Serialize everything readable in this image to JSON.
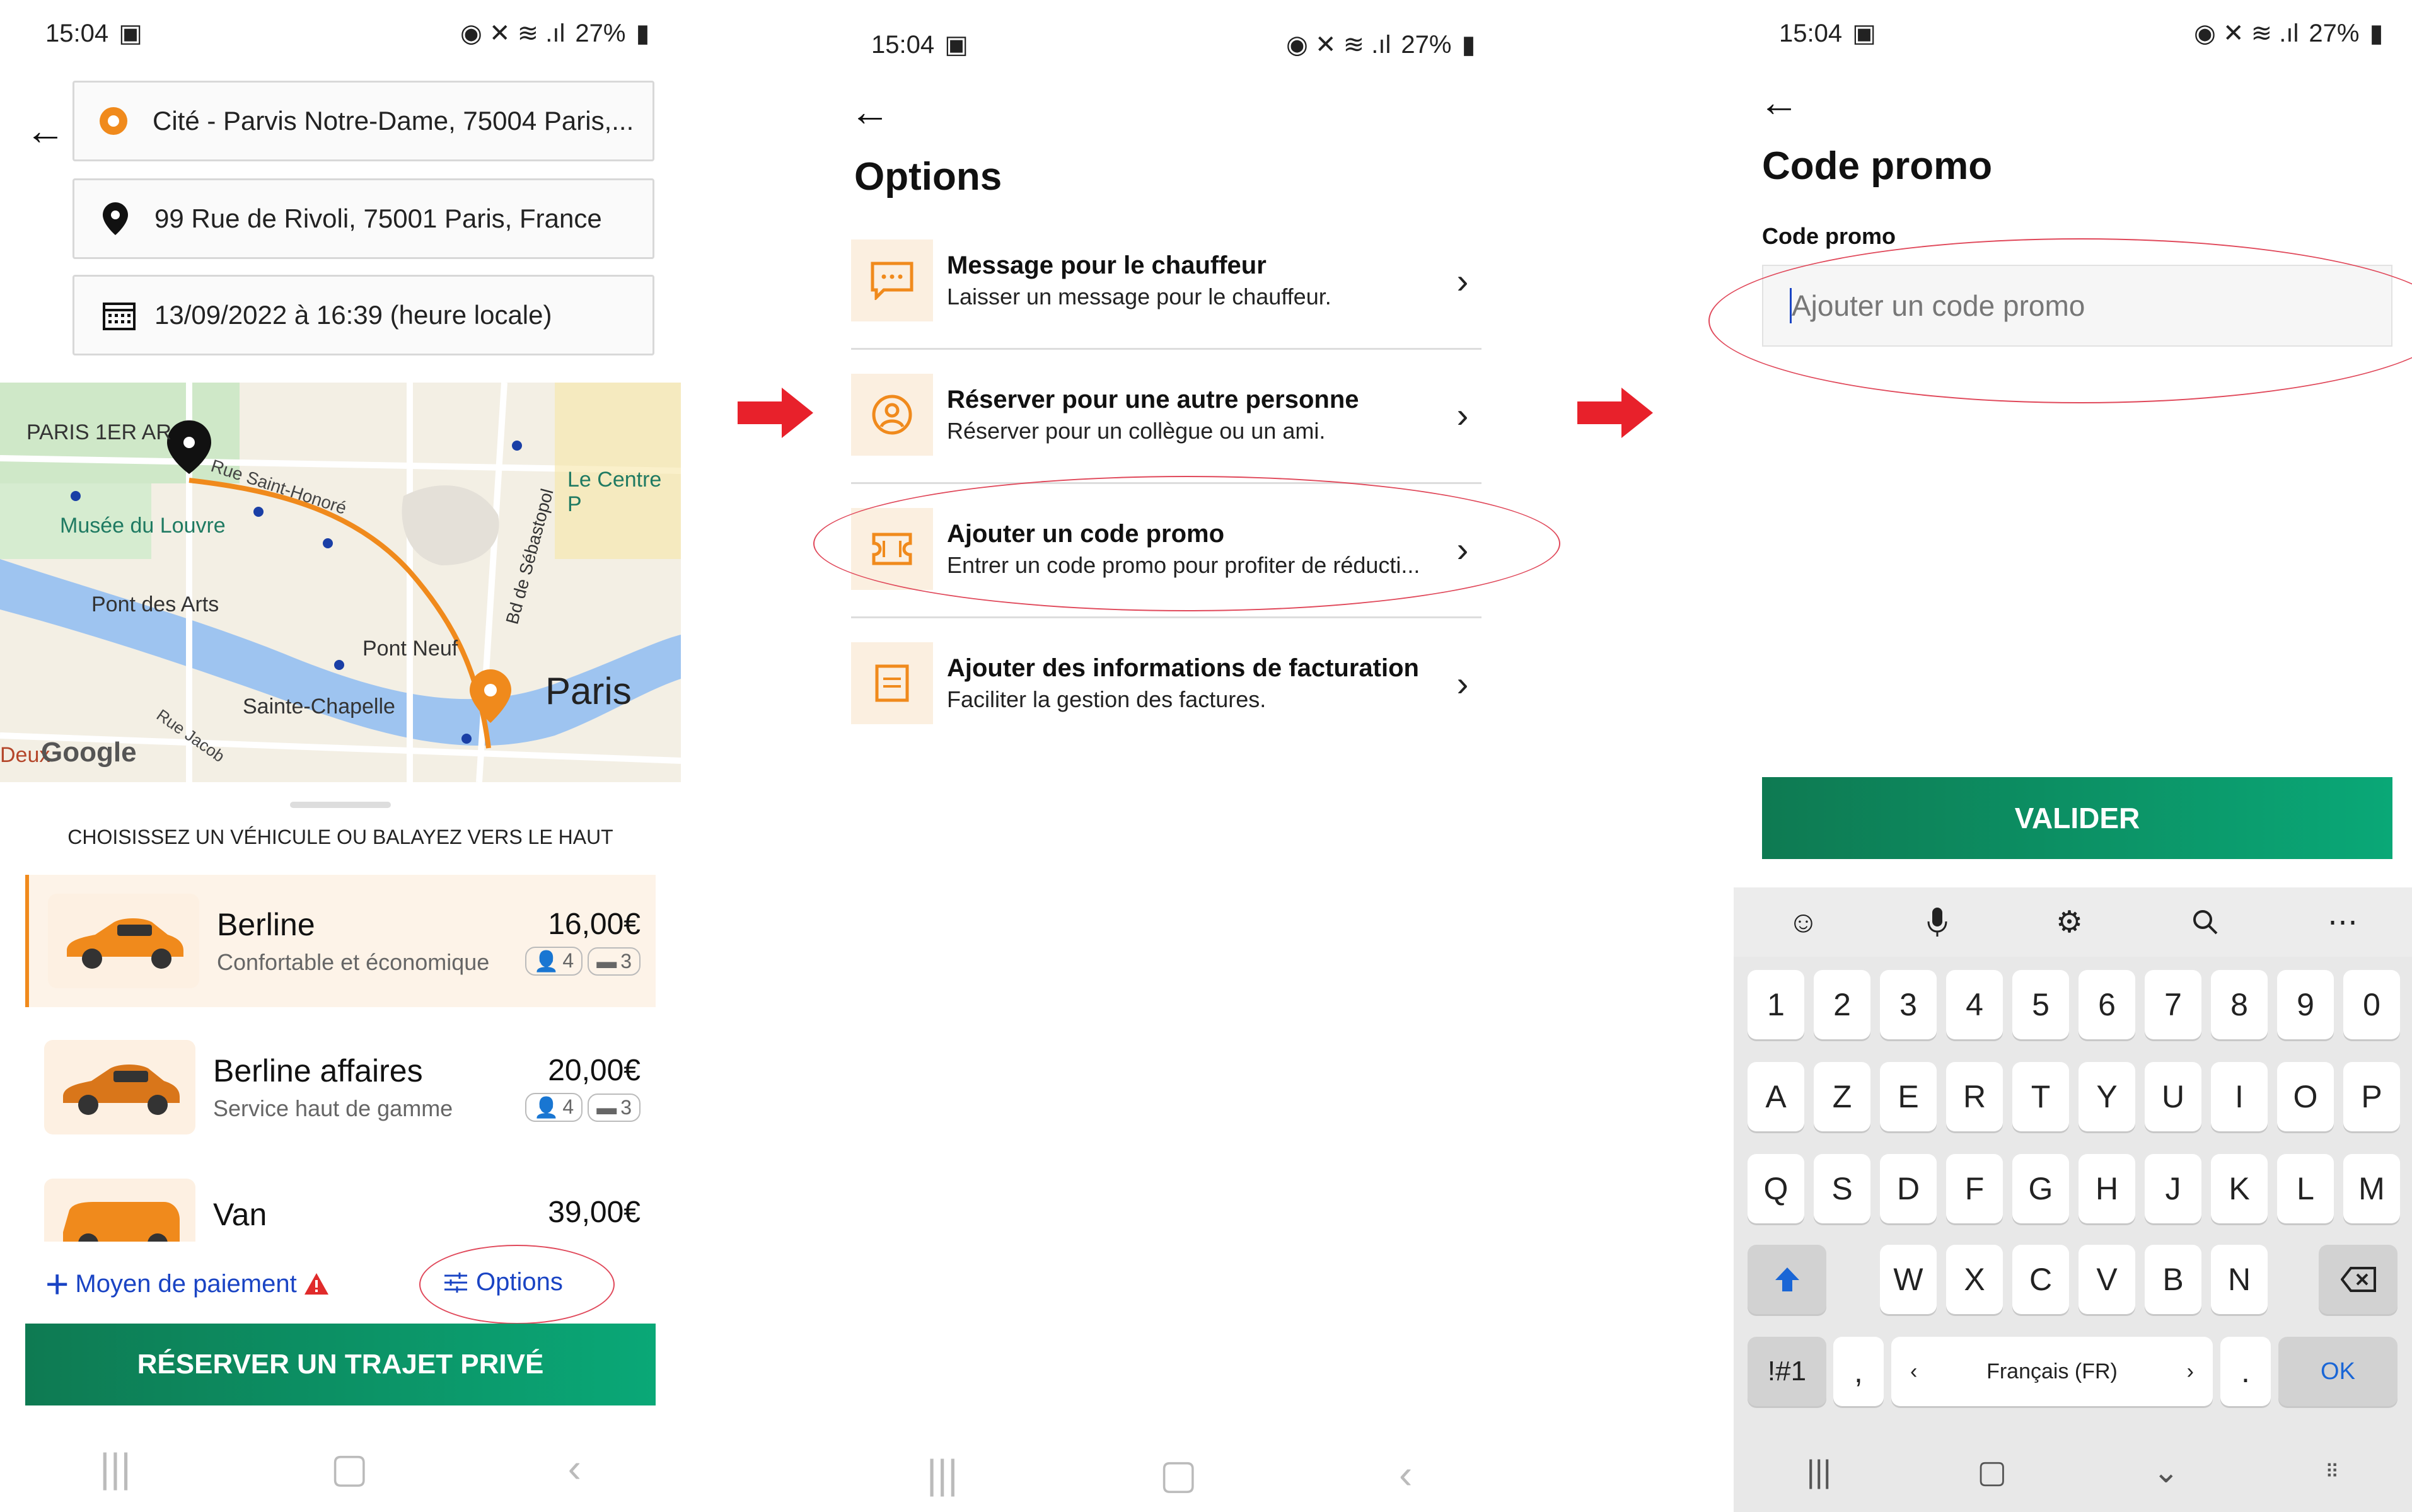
{
  "colors": {
    "orange": "#f08a1c",
    "green": "#0f8a5f",
    "blue": "#1a44c4",
    "red_arrow": "#e8212b",
    "annotation": "#e0485a"
  },
  "status": {
    "time": "15:04",
    "battery": "27%"
  },
  "screen1": {
    "pickup": "Cité - Parvis Notre-Dame, 75004 Paris,...",
    "dropoff": "99 Rue de Rivoli, 75001 Paris, France",
    "datetime": "13/09/2022 à 16:39 (heure locale)",
    "map": {
      "labels": [
        "PARIS 1ER AR",
        "Rue Saint-Honoré",
        "Musée du Louvre",
        "Le Centre P",
        "Bd de Sébastopol",
        "Pont des Arts",
        "Pont Neuf",
        "Paris",
        "Sainte-Chapelle",
        "Rue Jacob",
        "Deux"
      ],
      "google": "Google"
    },
    "prompt": "CHOISISSEZ UN VÉHICULE OU BALAYEZ VERS LE HAUT",
    "vehicles": [
      {
        "name": "Berline",
        "desc": "Confortable et économique",
        "price": "16,00€",
        "pax": "4",
        "bags": "3"
      },
      {
        "name": "Berline affaires",
        "desc": "Service haut de gamme",
        "price": "20,00€",
        "pax": "4",
        "bags": "3"
      },
      {
        "name": "Van",
        "price": "39,00€"
      }
    ],
    "payment": "Moyen de paiement",
    "options": "Options",
    "book": "RÉSERVER UN TRAJET PRIVÉ"
  },
  "screen2": {
    "title": "Options",
    "items": [
      {
        "title": "Message pour le chauffeur",
        "sub": "Laisser un message pour le chauffeur.",
        "icon": "message-icon"
      },
      {
        "title": "Réserver pour une autre personne",
        "sub": "Réserver pour un collègue ou un ami.",
        "icon": "person-icon"
      },
      {
        "title": "Ajouter un code promo",
        "sub": "Entrer un code promo pour profiter de réducti...",
        "icon": "ticket-icon"
      },
      {
        "title": "Ajouter des informations de facturation",
        "sub": "Faciliter la gestion des factures.",
        "icon": "invoice-icon"
      }
    ]
  },
  "screen3": {
    "title": "Code promo",
    "label": "Code promo",
    "placeholder": "Ajouter un code promo",
    "validate": "VALIDER",
    "keyboard": {
      "row1": [
        "1",
        "2",
        "3",
        "4",
        "5",
        "6",
        "7",
        "8",
        "9",
        "0"
      ],
      "row2": [
        "A",
        "Z",
        "E",
        "R",
        "T",
        "Y",
        "U",
        "I",
        "O",
        "P"
      ],
      "row3": [
        "Q",
        "S",
        "D",
        "F",
        "G",
        "H",
        "J",
        "K",
        "L",
        "M"
      ],
      "row4": [
        "W",
        "X",
        "C",
        "V",
        "B",
        "N"
      ],
      "sym": "!#1",
      "comma": ",",
      "lang": "Français (FR)",
      "period": ".",
      "ok": "OK"
    }
  }
}
